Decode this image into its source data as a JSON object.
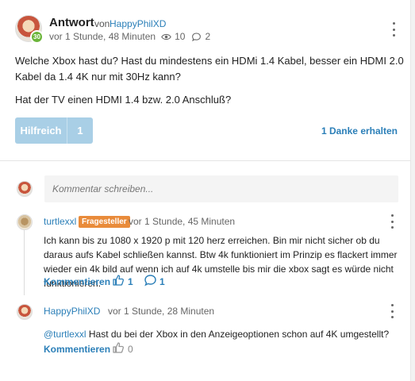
{
  "answer": {
    "title": "Antwort",
    "von": "von",
    "author": "HappyPhilXD",
    "level": "30",
    "time": "vor 1 Stunde, 48 Minuten",
    "views": "10",
    "comments_count": "2",
    "paragraph1": "Welche Xbox hast du? Hast du mindestens ein HDMi 1.4 Kabel, besser ein HDMI 2.0 Kabel da 1.4 4K nur mit 30Hz kann?",
    "paragraph2": "Hat der TV einen HDMI 1.4 bzw. 2.0 Anschluß?",
    "helpful_label": "Hilfreich",
    "helpful_count": "1",
    "thanks": "1 Danke erhalten"
  },
  "comment_box": {
    "placeholder": "Kommentar schreiben..."
  },
  "comments": [
    {
      "user": "turtlexxl",
      "tag": "Fragesteller",
      "time": "vor 1 Stunde, 45 Minuten",
      "text": "Ich kann bis zu 1080 x 1920 p mit 120 herz erreichen. Bin mir nicht sicher ob du daraus aufs Kabel schließen kannst. Btw 4k funktioniert im Prinzip es flackert immer wieder ein 4k bild auf wenn ich auf 4k umstelle bis mir die xbox sagt es würde nicht funktionieren.",
      "action": "Kommentieren",
      "likes": "1",
      "replies": "1"
    },
    {
      "user": "HappyPhilXD",
      "time": "vor 1 Stunde, 28 Minuten",
      "mention": "@turtlexxl",
      "text": "Hast du bei der Xbox in den Anzeigeoptionen schon auf 4K umgestellt?",
      "action": "Kommentieren",
      "likes": "0"
    }
  ],
  "colors": {
    "link": "#2b7fb8",
    "helpful_button": "#a9cfe6",
    "tag": "#e98b3a",
    "level_badge": "#6bb53a"
  }
}
